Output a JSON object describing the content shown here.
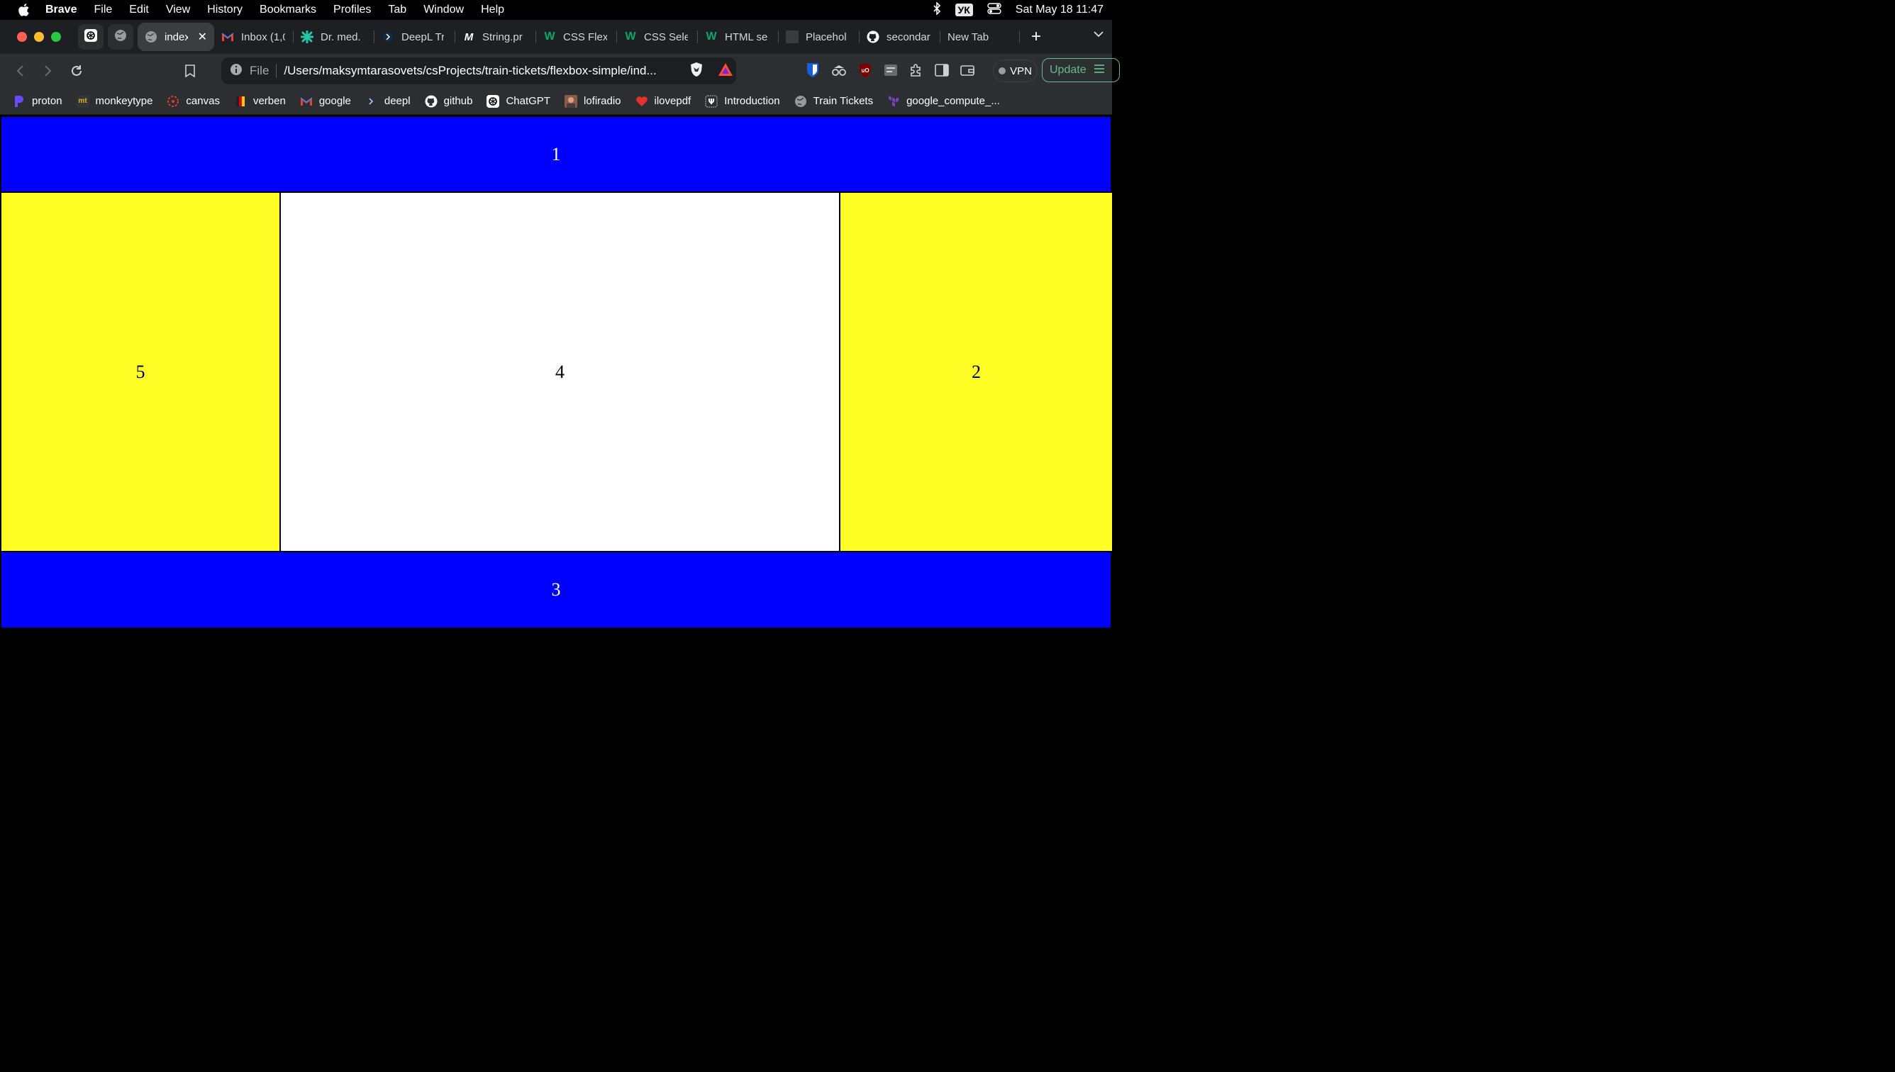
{
  "menubar": {
    "app_name": "Brave",
    "items": [
      "File",
      "Edit",
      "View",
      "History",
      "Bookmarks",
      "Profiles",
      "Tab",
      "Window",
      "Help"
    ],
    "keyboard_layout": "УК",
    "datetime": "Sat May 18  11:47"
  },
  "tabs": [
    {
      "label": "index",
      "icon": "globe-icon",
      "active": true
    },
    {
      "label": "Inbox (1,0",
      "icon": "gmail-icon"
    },
    {
      "label": "Dr. med.",
      "icon": "drmed-icon"
    },
    {
      "label": "DeepL Tr",
      "icon": "deepl-icon"
    },
    {
      "label": "String.pr",
      "icon": "mdn-icon"
    },
    {
      "label": "CSS Flex",
      "icon": "w3schools-icon"
    },
    {
      "label": "CSS Sele",
      "icon": "w3schools-icon"
    },
    {
      "label": "HTML se",
      "icon": "w3schools-icon"
    },
    {
      "label": "Placehol",
      "icon": "placeholder-icon"
    },
    {
      "label": "secondar",
      "icon": "github-icon"
    },
    {
      "label": "New Tab",
      "icon": ""
    }
  ],
  "toolbar": {
    "scheme_label": "File",
    "url": "/Users/maksymtarasovets/csProjects/train-tickets/flexbox-simple/ind...",
    "vpn_label": "VPN",
    "update_label": "Update"
  },
  "bookmarks": [
    {
      "label": "proton",
      "icon": "proton-icon"
    },
    {
      "label": "monkeytype",
      "icon": "monkeytype-icon"
    },
    {
      "label": "canvas",
      "icon": "canvas-icon"
    },
    {
      "label": "verben",
      "icon": "verben-icon"
    },
    {
      "label": "google",
      "icon": "gmail-icon"
    },
    {
      "label": "deepl",
      "icon": "deepl-icon"
    },
    {
      "label": "github",
      "icon": "github-icon"
    },
    {
      "label": "ChatGPT",
      "icon": "chatgpt-icon"
    },
    {
      "label": "lofiradio",
      "icon": "lofiradio-icon"
    },
    {
      "label": "ilovepdf",
      "icon": "heart-icon"
    },
    {
      "label": "Introduction",
      "icon": "introduction-icon"
    },
    {
      "label": "Train Tickets",
      "icon": "globe-icon"
    },
    {
      "label": "google_compute_...",
      "icon": "terraform-icon"
    }
  ],
  "page": {
    "box1": "1",
    "box2": "2",
    "box3": "3",
    "box4": "4",
    "box5": "5"
  },
  "colors": {
    "blue_box": "#0000ff",
    "yellow_box": "#ffff25",
    "white_box": "#ffffff"
  }
}
